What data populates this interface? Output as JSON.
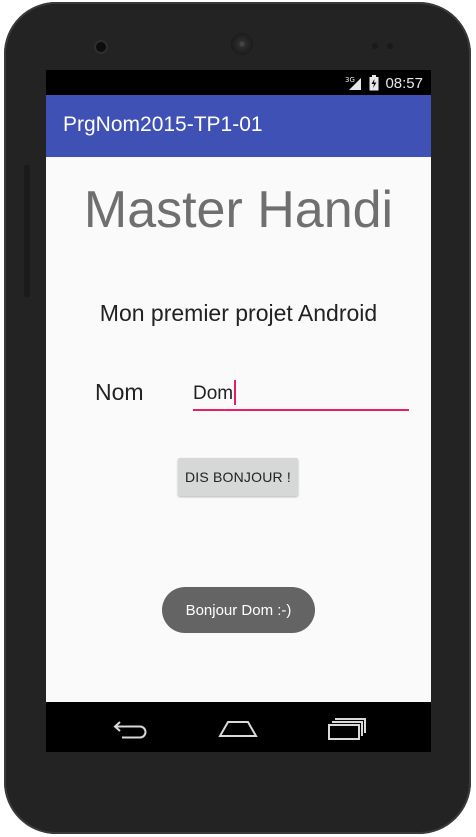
{
  "status_bar": {
    "network": "3G",
    "time": "08:57"
  },
  "app_bar": {
    "title": "PrgNom2015-TP1-01"
  },
  "content": {
    "headline": "Master Handi",
    "subtitle": "Mon premier projet Android",
    "name_label": "Nom",
    "name_value": "Dom",
    "button_label": "DIS BONJOUR !"
  },
  "toast": {
    "message": "Bonjour Dom :-)"
  },
  "nav_bar": {
    "icons": [
      "back-icon",
      "home-icon",
      "recents-icon"
    ]
  },
  "colors": {
    "app_bar": "#3f51b5",
    "accent": "#e91e63",
    "background": "#fafafa",
    "button": "#d6d7d7",
    "toast": "#646464",
    "headline": "#6f6f6f"
  }
}
